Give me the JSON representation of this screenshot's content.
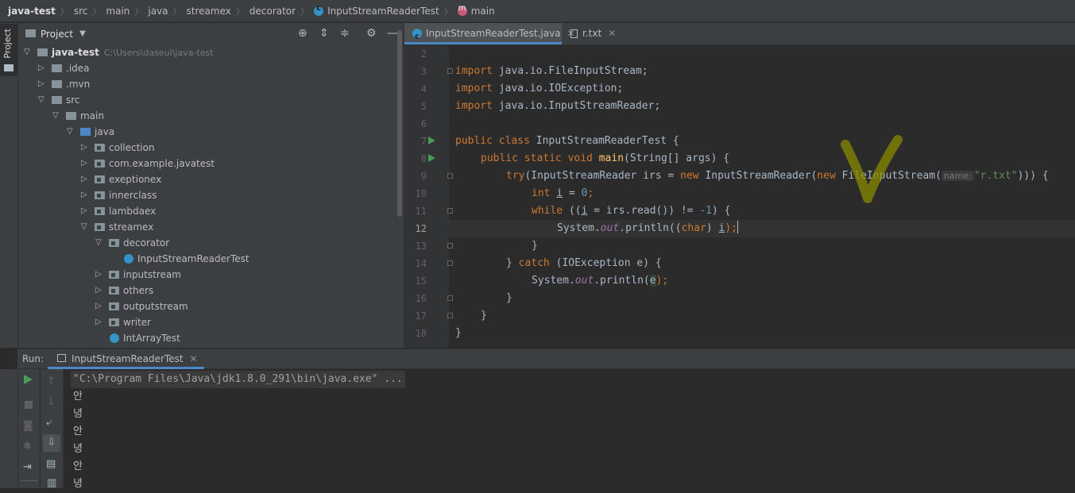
{
  "breadcrumb": {
    "items": [
      "java-test",
      "src",
      "main",
      "java",
      "streamex",
      "decorator",
      "InputStreamReaderTest",
      "main"
    ]
  },
  "sidebar": {
    "project_tab": "Project"
  },
  "project_panel": {
    "title": "Project",
    "tree": [
      {
        "label": "java-test",
        "path": "C:\\Users\\daseul\\java-test"
      },
      {
        "label": ".idea"
      },
      {
        "label": ".mvn"
      },
      {
        "label": "src"
      },
      {
        "label": "main"
      },
      {
        "label": "java"
      },
      {
        "label": "collection"
      },
      {
        "label": "com.example.javatest"
      },
      {
        "label": "exeptionex"
      },
      {
        "label": "innerclass"
      },
      {
        "label": "lambdaex"
      },
      {
        "label": "streamex"
      },
      {
        "label": "decorator"
      },
      {
        "label": "InputStreamReaderTest"
      },
      {
        "label": "inputstream"
      },
      {
        "label": "others"
      },
      {
        "label": "outputstream"
      },
      {
        "label": "writer"
      },
      {
        "label": "IntArrayTest"
      }
    ]
  },
  "editor": {
    "tabs": [
      {
        "label": "InputStreamReaderTest.java",
        "active": true
      },
      {
        "label": "r.txt",
        "active": false
      }
    ],
    "line_numbers": [
      "2",
      "3",
      "4",
      "5",
      "6",
      "7",
      "8",
      "9",
      "10",
      "11",
      "12",
      "13",
      "14",
      "15",
      "16",
      "17",
      "18"
    ],
    "current_line": "12",
    "code": {
      "import_kw": "import",
      "import1": " java.io.FileInputStream;",
      "import2": " java.io.IOException;",
      "import3": " java.io.InputStreamReader;",
      "l7_kw": "public class",
      "l7_rest": " InputStreamReaderTest {",
      "l8_kw": "public static void",
      "l8_fn": "main",
      "l8_rest": "(String[] args) {",
      "l9_try": "try",
      "l9_a": "(InputStreamReader irs = ",
      "new": "new",
      "l9_b": " InputStreamReader(",
      "l9_c": " FileInputStream(",
      "l9_hint": "name:",
      "l9_str": "\"r.txt\"",
      "l9_end": "))) {",
      "l10_kw": "int",
      "l10_var": "i",
      "l10_eq": " = ",
      "l10_num": "0",
      "l10_end": ";",
      "l11_kw": "while",
      "l11_a": " ((",
      "l11_var": "i",
      "l11_b": " = irs.read()) != ",
      "l11_num": "-1",
      "l11_c": ") {",
      "sys": "System.",
      "out": "out",
      "l12_a": ".println((",
      "l12_kw": "char",
      "l12_b": ") ",
      "l12_var": "i",
      "l12_c": ");",
      "close_brace": "}",
      "l14_a": "} ",
      "l14_kw": "catch",
      "l14_b": " (IOException e) {",
      "l15_a": ".println(",
      "l15_e": "e",
      "l15_b": ");"
    }
  },
  "run_panel": {
    "label": "Run:",
    "tab": "InputStreamReaderTest",
    "console": [
      "\"C:\\Program Files\\Java\\jdk1.8.0_291\\bin\\java.exe\" ...",
      "안",
      "녕",
      "안",
      "녕",
      "안",
      "녕"
    ]
  },
  "colors": {
    "accent": "#4a88c7",
    "run_green": "#499c54",
    "annotation_mark": "#9a9a00"
  }
}
